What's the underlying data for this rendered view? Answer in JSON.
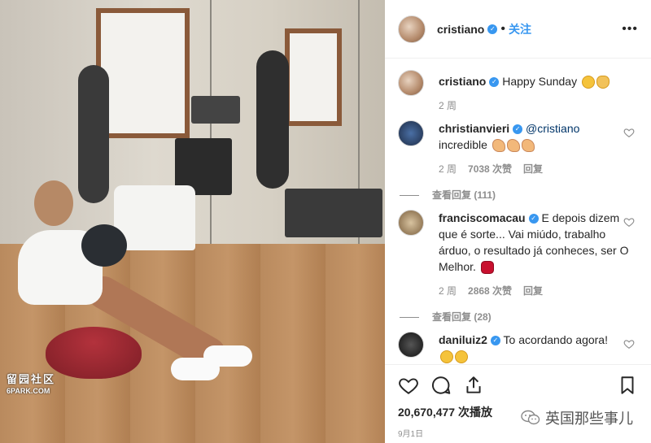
{
  "photo": {
    "watermark_line1": "留园社区",
    "watermark_line2": "6PARK.COM"
  },
  "post": {
    "username": "cristiano",
    "dot": "•",
    "follow_label": "关注",
    "more_label": "•••",
    "caption": {
      "username": "cristiano",
      "text": "Happy Sunday",
      "time": "2 周"
    }
  },
  "comments": [
    {
      "username": "christianvieri",
      "mention": "@cristiano",
      "text": "incredible",
      "time": "2 周",
      "likes": "7038 次赞",
      "reply": "回复",
      "view_replies": "查看回复 (111)"
    },
    {
      "username": "franciscomacau",
      "text": "E depois dizem que é sorte... Vai miúdo, trabalho árduo, o resultado já conheces, ser O Melhor.",
      "time": "2 周",
      "likes": "2868 次赞",
      "reply": "回复",
      "view_replies": "查看回复 (28)"
    },
    {
      "username": "daniluiz2",
      "text": "To acordando agora!"
    }
  ],
  "footer": {
    "views": "20,670,477 次播放",
    "date": "9月1日",
    "wechat_label": "英国那些事儿"
  },
  "icons": {
    "like": "heart-icon",
    "comment": "comment-icon",
    "share": "share-icon",
    "save": "bookmark-icon",
    "verified": "verified-badge-icon"
  },
  "colors": {
    "accent": "#3897f0",
    "muted": "#8e8e8e",
    "text": "#262626"
  }
}
